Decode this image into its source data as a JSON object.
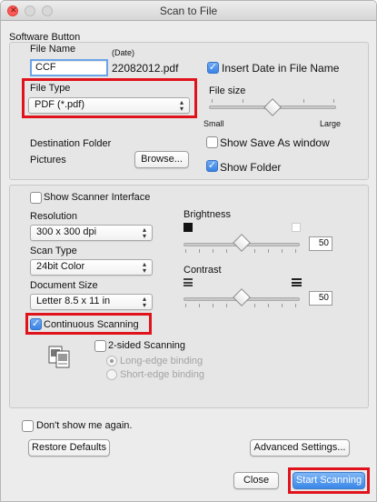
{
  "window": {
    "title": "Scan to File"
  },
  "software_button": {
    "label": "Software Button",
    "file_name_label": "File Name",
    "date_label": "(Date)",
    "file_name_value": "CCF",
    "file_name_preview": "22082012.pdf",
    "insert_date_label": "Insert Date in File Name",
    "insert_date_checked": true,
    "file_type_label": "File Type",
    "file_type_value": "PDF (*.pdf)",
    "file_size_label": "File size",
    "file_size_small": "Small",
    "file_size_large": "Large",
    "file_size_level": 0.5,
    "destination_folder_label": "Destination Folder",
    "destination_folder_value": "Pictures",
    "browse_label": "Browse...",
    "show_save_as_label": "Show Save As window",
    "show_save_as_checked": false,
    "show_folder_label": "Show Folder",
    "show_folder_checked": true
  },
  "scanner": {
    "show_scanner_interface_label": "Show Scanner Interface",
    "show_scanner_interface_checked": false,
    "resolution_label": "Resolution",
    "resolution_value": "300 x 300 dpi",
    "scan_type_label": "Scan Type",
    "scan_type_value": "24bit Color",
    "document_size_label": "Document Size",
    "document_size_value": "Letter 8.5 x 11 in",
    "brightness_label": "Brightness",
    "brightness_value": "50",
    "contrast_label": "Contrast",
    "contrast_value": "50",
    "continuous_scanning_label": "Continuous Scanning",
    "continuous_scanning_checked": true,
    "two_sided_label": "2-sided Scanning",
    "two_sided_checked": false,
    "long_edge_label": "Long-edge binding",
    "short_edge_label": "Short-edge binding"
  },
  "footer": {
    "dont_show_label": "Don't show me again.",
    "restore_defaults_label": "Restore Defaults",
    "advanced_settings_label": "Advanced Settings...",
    "close_label": "Close",
    "start_scanning_label": "Start Scanning"
  },
  "colors": {
    "highlight": "#e0131c",
    "accent": "#3a87e8"
  }
}
